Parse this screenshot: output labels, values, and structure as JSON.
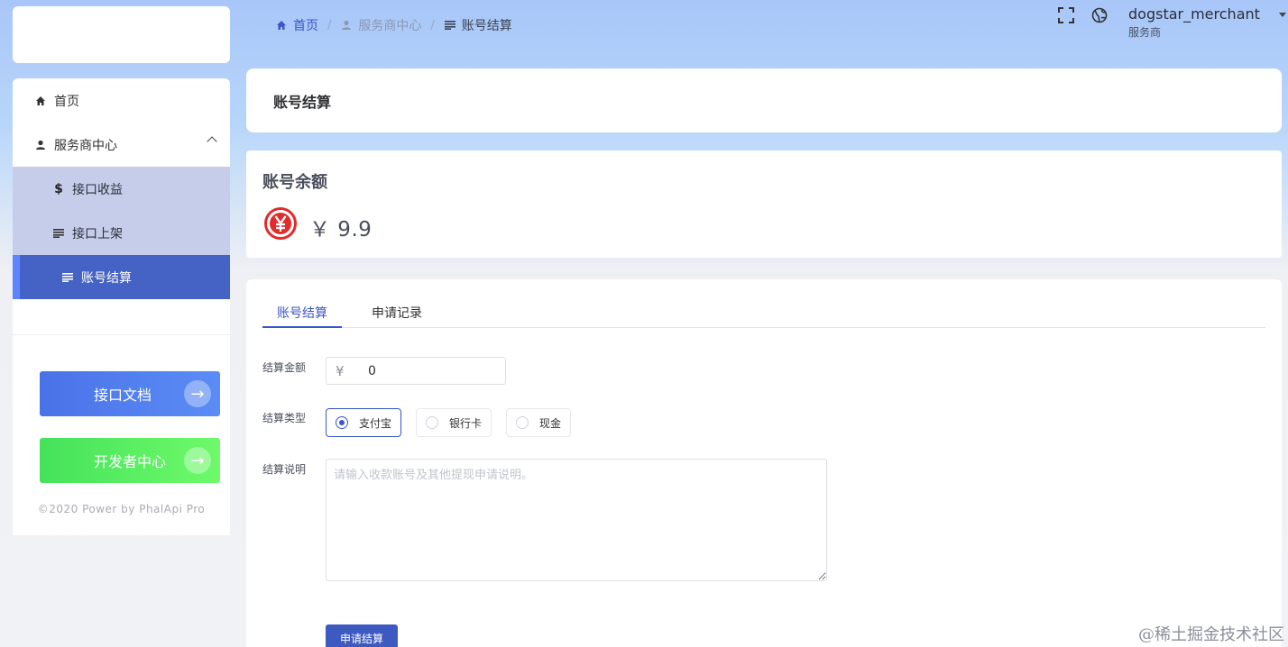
{
  "sidebar": {
    "menu": {
      "home": {
        "label": "首页",
        "icon": "home-icon"
      },
      "provider": {
        "label": "服务商中心",
        "icon": "user-icon"
      },
      "submenu": [
        {
          "label": "接口收益",
          "icon": "dollar-icon"
        },
        {
          "label": "接口上架",
          "icon": "list-icon"
        },
        {
          "label": "账号结算",
          "icon": "list-icon",
          "active": true
        }
      ]
    },
    "buttons": {
      "docs": {
        "label": "接口文档",
        "icon": "arrow-right-icon"
      },
      "developer": {
        "label": "开发者中心",
        "icon": "arrow-right-icon"
      }
    },
    "copyright": "©2020 Power by PhalApi Pro"
  },
  "header": {
    "breadcrumb": [
      {
        "label": "首页",
        "icon": "home-icon"
      },
      {
        "label": "服务商中心",
        "icon": "user-icon"
      },
      {
        "label": "账号结算",
        "icon": "list-icon"
      }
    ],
    "separator": "/",
    "icons": [
      "fullscreen-icon",
      "globe-icon"
    ],
    "user": {
      "name": "dogstar_merchant",
      "role": "服务商"
    }
  },
  "page": {
    "title": "账号结算",
    "balance": {
      "label": "账号余额",
      "value": "￥ 9.9",
      "icon": "yen-circle-icon"
    },
    "tabs": [
      {
        "label": "账号结算",
        "active": true
      },
      {
        "label": "申请记录",
        "active": false
      }
    ],
    "form": {
      "amount_label": "结算金额",
      "currency": "¥",
      "amount_value": "0",
      "type_label": "结算类型",
      "types": [
        {
          "label": "支付宝",
          "checked": true
        },
        {
          "label": "银行卡",
          "checked": false
        },
        {
          "label": "现金",
          "checked": false
        }
      ],
      "note_label": "结算说明",
      "note_placeholder": "请输入收款账号及其他提现申请说明。",
      "submit_label": "申请结算"
    }
  },
  "watermark": "@稀土掘金技术社区",
  "colors": {
    "accent": "#3a55c8",
    "active_menu": "#4563c4",
    "submenu_bg": "#c5cdea",
    "docs_button": "#4a72e8",
    "dev_button": "#45e25a",
    "yen_icon": "#e22b2b"
  }
}
